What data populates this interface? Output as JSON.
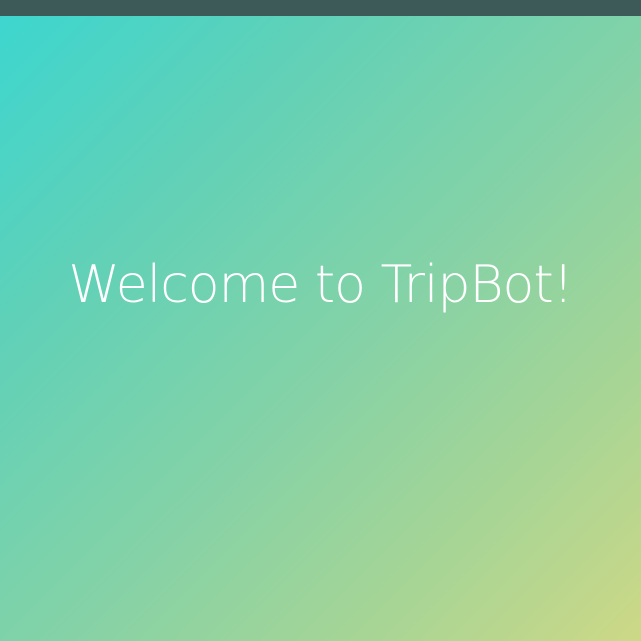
{
  "welcome": {
    "title": "Welcome to TripBot!"
  },
  "colors": {
    "top_bar": "#3d5a58",
    "gradient_start": "#3dd6cf",
    "gradient_end": "#cdd886",
    "text": "#ffffff"
  }
}
